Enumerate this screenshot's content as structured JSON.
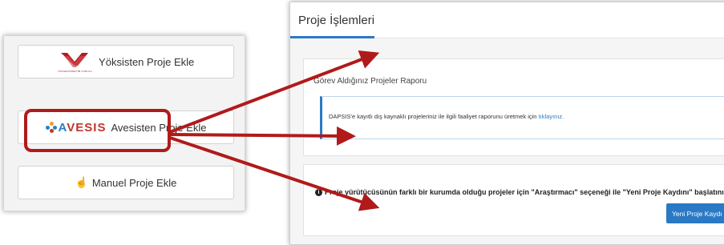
{
  "left_panel": {
    "yoksis_button": {
      "label": "Yöksisten Proje Ekle",
      "logo_sub": "YÜKSEKÖĞRETİM KURULU"
    },
    "avesis_button": {
      "label": "Avesisten Proje Ekle",
      "logo_word_first": "A",
      "logo_word_rest": "VESIS"
    },
    "manual_button": {
      "label": "Manuel Proje Ekle"
    }
  },
  "right_panel": {
    "tab_title": "Proje İşlemleri",
    "report_card": {
      "title": "Görev Aldığınız Projeler Raporu",
      "text": "DAPSIS'e kayıtlı dış kaynaklı projeleriniz ile ilgili faaliyet raporunu üretmek için",
      "link": "tıklayınız."
    },
    "new_project_card": {
      "info_text": "Proje yürütücüsünün farklı bir kurumda olduğu projeler için \"Araştırmacı\" seçeneği ile \"Yeni Proje Kaydını\" başlatınız.",
      "button_label": "Yeni Proje Kaydı"
    }
  },
  "colors": {
    "accent": "#2a79c4",
    "highlight_red": "#b11a1a",
    "yok_red": "#b21c24"
  }
}
